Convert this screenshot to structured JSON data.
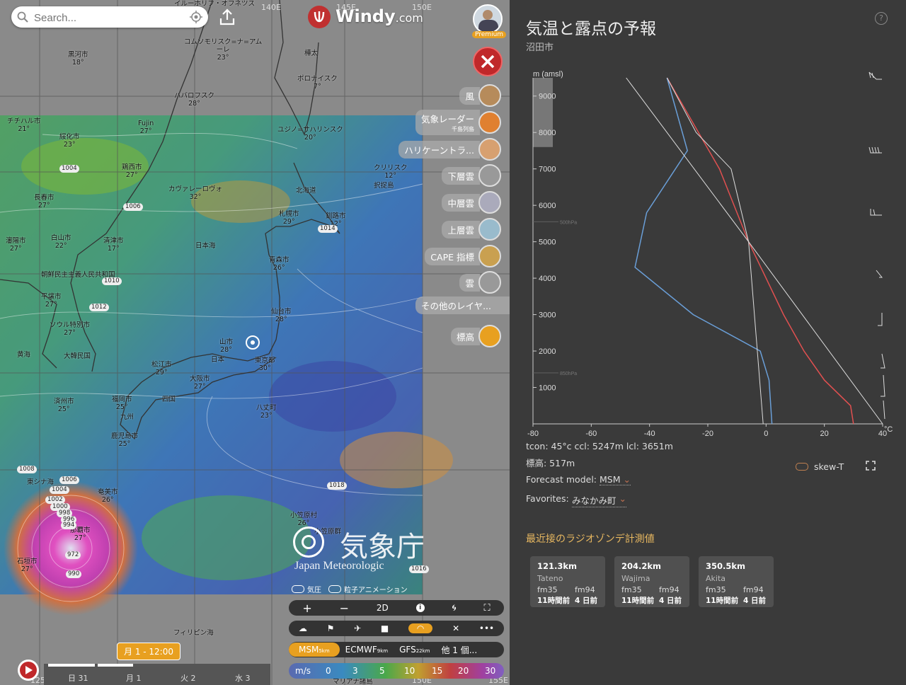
{
  "search": {
    "placeholder": "Search..."
  },
  "brand": {
    "name": "Windy",
    "suffix": ".com"
  },
  "premium_label": "Premium",
  "longitudes": [
    "140E",
    "145E",
    "150E",
    "125E",
    "155E"
  ],
  "cities": [
    {
      "name": "イルーホリフ・オフネツス",
      "t": ""
    },
    {
      "name": "黒河市",
      "t": "18°"
    },
    {
      "name": "コムソモリスク=ナ=アム",
      "t": "ーレ\n23°"
    },
    {
      "name": "樺太",
      "t": ""
    },
    {
      "name": "ポロナイスク",
      "t": "7°"
    },
    {
      "name": "ハバロフスク",
      "t": "28°"
    },
    {
      "name": "チチハル市",
      "t": "21°"
    },
    {
      "name": "Fujin",
      "t": "27°"
    },
    {
      "name": "ユジノ=サハリンスク",
      "t": "20°"
    },
    {
      "name": "綏化市",
      "t": "23°"
    },
    {
      "name": "クリリスク",
      "t": "12°"
    },
    {
      "name": "択捉島",
      "t": ""
    },
    {
      "name": "鶏西市",
      "t": "27°"
    },
    {
      "name": "北海道",
      "t": ""
    },
    {
      "name": "長春市",
      "t": "27°"
    },
    {
      "name": "カヴァレーロヴォ",
      "t": "32°"
    },
    {
      "name": "札幌市",
      "t": "29°"
    },
    {
      "name": "釧路市",
      "t": "12°"
    },
    {
      "name": "白山市",
      "t": "22°"
    },
    {
      "name": "清津市",
      "t": "17°"
    },
    {
      "name": "日本海",
      "t": ""
    },
    {
      "name": "瀋陽市",
      "t": "27°"
    },
    {
      "name": "青森市",
      "t": "26°"
    },
    {
      "name": "朝鮮民主主義人民共和国",
      "t": ""
    },
    {
      "name": "平壌市",
      "t": "27°"
    },
    {
      "name": "仙台市",
      "t": "28°"
    },
    {
      "name": "ソウル特別市",
      "t": "27°"
    },
    {
      "name": "大韓民国",
      "t": ""
    },
    {
      "name": "山市",
      "t": "28°"
    },
    {
      "name": "日本",
      "t": ""
    },
    {
      "name": "東京都",
      "t": "30°"
    },
    {
      "name": "黄海",
      "t": ""
    },
    {
      "name": "松江市",
      "t": "29°"
    },
    {
      "name": "大阪市",
      "t": "27°"
    },
    {
      "name": "四国",
      "t": ""
    },
    {
      "name": "福岡市",
      "t": "25°"
    },
    {
      "name": "九州",
      "t": ""
    },
    {
      "name": "八丈町",
      "t": "23°"
    },
    {
      "name": "済州市",
      "t": "25°"
    },
    {
      "name": "鹿児島市",
      "t": "25°"
    },
    {
      "name": "東シナ海",
      "t": ""
    },
    {
      "name": "奄美市",
      "t": "26°"
    },
    {
      "name": "那覇市",
      "t": "27°"
    },
    {
      "name": "小笠原村",
      "t": "26°"
    },
    {
      "name": "小笠原群",
      "t": ""
    },
    {
      "name": "石垣市",
      "t": "27°"
    },
    {
      "name": "フィリピン海",
      "t": ""
    },
    {
      "name": "マリアナ諸島",
      "t": ""
    }
  ],
  "isobars": [
    "1004",
    "1006",
    "1010",
    "1012",
    "1014",
    "1018",
    "1008",
    "1006",
    "1004",
    "1002",
    "1000",
    "998",
    "996",
    "994",
    "972",
    "990",
    "1016"
  ],
  "layers": [
    {
      "label": "風",
      "color": "#b68b5b"
    },
    {
      "label": "気象レーダー",
      "sub": "千島列島",
      "color": "#e08030"
    },
    {
      "label": "ハリケーントラ...",
      "color": "#d7a070"
    },
    {
      "label": "下層雲",
      "color": "#999"
    },
    {
      "label": "中層雲",
      "color": "#aab"
    },
    {
      "label": "上層雲",
      "color": "#9bc"
    },
    {
      "label": "CAPE 指標",
      "color": "#c9a050"
    },
    {
      "label": "雲",
      "color": "#999"
    },
    {
      "label": "その他のレイヤ..."
    },
    {
      "label": "標高",
      "color": "#e8a020"
    }
  ],
  "jma": {
    "name": "気象庁",
    "en": "Japan Meteorologic"
  },
  "map_toggles": {
    "pressure": "気圧",
    "particles": "粒子アニメーション"
  },
  "controls": {
    "plus": "+",
    "minus": "−",
    "mode": "2D"
  },
  "models": [
    {
      "name": "MSM",
      "res": "5km"
    },
    {
      "name": "ECMWF",
      "res": "9km"
    },
    {
      "name": "GFS",
      "res": "22km"
    },
    {
      "name": "他 1 個...",
      "res": ""
    }
  ],
  "scale": {
    "unit": "m/s",
    "values": [
      "0",
      "3",
      "5",
      "10",
      "15",
      "20",
      "30"
    ]
  },
  "timeline": {
    "current": "月 1 - 12:00",
    "days": [
      "日 31",
      "月 1",
      "火 2",
      "水 3"
    ]
  },
  "panel": {
    "title": "気温と露点の予報",
    "location": "沼田市",
    "yaxis_label": "m (amsl)",
    "y_ticks": [
      "9000",
      "8000",
      "7000",
      "6000",
      "5000",
      "4000",
      "3000",
      "2000",
      "1000"
    ],
    "x_ticks": [
      "-80",
      "-60",
      "-40",
      "-20",
      "0",
      "20",
      "40"
    ],
    "x_unit": "°C",
    "pressure_labels": [
      "500hPa",
      "850hPa"
    ],
    "stats": "tcon: 45°c ccl: 5247m lcl: 3651m",
    "elevation": "標高: 517m",
    "skewt_label": "skew-T",
    "forecast_model_label": "Forecast model:",
    "forecast_model_value": "MSM",
    "favorites_label": "Favorites:",
    "favorites_value": "みなかみ町",
    "radiosonde_title": "最近接のラジオゾンデ計測値",
    "stations": [
      {
        "dist": "121.3km",
        "name": "Tateno",
        "m1": "fm35",
        "m2": "fm94",
        "t1": "11時間前",
        "t2": "4 日前"
      },
      {
        "dist": "204.2km",
        "name": "Wajima",
        "m1": "fm35",
        "m2": "fm94",
        "t1": "11時間前",
        "t2": "4 日前"
      },
      {
        "dist": "350.5km",
        "name": "Akita",
        "m1": "fm35",
        "m2": "fm94",
        "t1": "11時間前",
        "t2": "4 日前"
      }
    ]
  },
  "chart_data": {
    "type": "line",
    "title": "気温と露点の予報",
    "xlabel": "°C",
    "ylabel": "m (amsl)",
    "xlim": [
      -80,
      40
    ],
    "ylim": [
      0,
      9500
    ],
    "series": [
      {
        "name": "",
        "color": "#e05050",
        "x": [
          30,
          29,
          20,
          13,
          6,
          -6,
          -16,
          -34
        ],
        "y": [
          0,
          500,
          1200,
          2000,
          3000,
          5000,
          7000,
          9500
        ]
      },
      {
        "name": "",
        "color": "#6a9fd8",
        "x": [
          2,
          1,
          -2,
          -25,
          -45,
          -41,
          -27,
          -34
        ],
        "y": [
          0,
          1200,
          2000,
          3000,
          4300,
          5800,
          7500,
          9500
        ]
      },
      {
        "name": "",
        "color": "#dddddd",
        "x": [
          -1,
          -6,
          -12,
          -24,
          -34
        ],
        "y": [
          0,
          5000,
          7000,
          8000,
          9500
        ]
      },
      {
        "name": "",
        "color": "#dddddd",
        "x": [
          40,
          -6,
          -48
        ],
        "y": [
          0,
          5000,
          9500
        ]
      }
    ]
  }
}
